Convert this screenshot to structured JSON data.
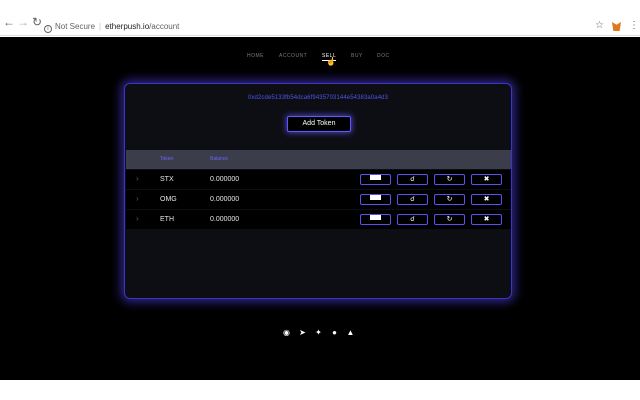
{
  "browser": {
    "security_label": "Not Secure",
    "separator": "|",
    "host": "etherpush.io",
    "path": "/account",
    "icons": [
      "back-icon",
      "forward-icon",
      "reload-icon",
      "info-icon",
      "star-icon",
      "metamask-extension-icon",
      "kebab-menu-icon"
    ]
  },
  "nav": {
    "items": [
      {
        "label": "HOME"
      },
      {
        "label": "ACCOUNT"
      },
      {
        "label": "SELL",
        "active": true
      },
      {
        "label": "BUY"
      },
      {
        "label": "DOC"
      }
    ]
  },
  "wallet": {
    "address": "0xd2cde5133fb54dca6f9435703144e54383a0a4d3"
  },
  "add_token_label": "Add Token",
  "table": {
    "headers": [
      "Token",
      "Balance"
    ],
    "rows": [
      {
        "token": "STX",
        "balance": "0.000000"
      },
      {
        "token": "OMG",
        "balance": "0.000000"
      },
      {
        "token": "ETH",
        "balance": "0.000000"
      }
    ],
    "actions": [
      "card-icon",
      "unlock-icon",
      "refresh-icon",
      "close-icon"
    ]
  },
  "footer": {
    "icons": [
      "github-icon",
      "telegram-icon",
      "twitter-icon",
      "wechat-icon",
      "qq-icon"
    ]
  },
  "colors": {
    "accent": "#5a52f0",
    "address": "#4f54e6",
    "background": "#000000",
    "panel": "#0d0e14",
    "table_header": "#3b3e4a"
  }
}
